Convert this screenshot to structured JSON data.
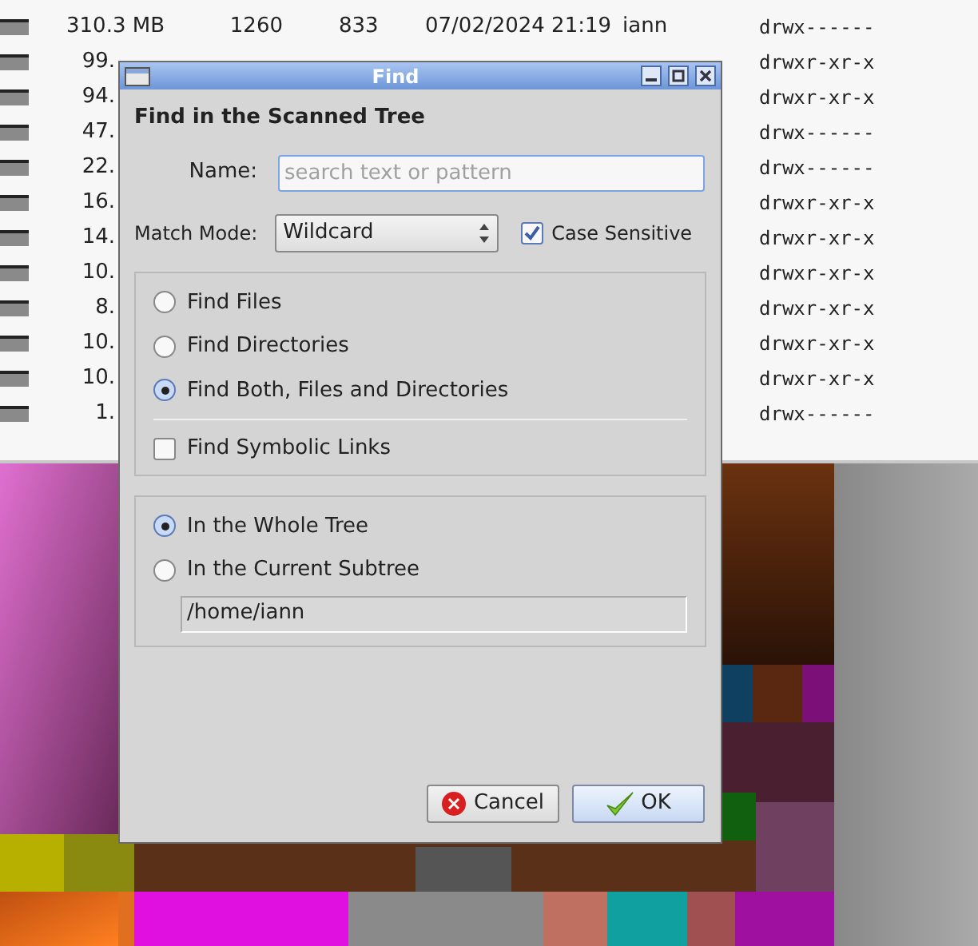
{
  "file_list": {
    "rows": [
      {
        "size": "310.3 MB",
        "items": "1260",
        "files": "833",
        "modified": "07/02/2024 21:19",
        "owner": "iann",
        "permissions": "drwx------"
      },
      {
        "size": "99.",
        "permissions": "drwxr-xr-x"
      },
      {
        "size": "94.",
        "permissions": "drwxr-xr-x"
      },
      {
        "size": "47.",
        "permissions": "drwx------"
      },
      {
        "size": "22.",
        "permissions": "drwx------"
      },
      {
        "size": "16.",
        "permissions": "drwxr-xr-x"
      },
      {
        "size": "14.",
        "permissions": "drwxr-xr-x"
      },
      {
        "size": "10.",
        "permissions": "drwxr-xr-x"
      },
      {
        "size": "8.",
        "permissions": "drwxr-xr-x"
      },
      {
        "size": "10.",
        "permissions": "drwxr-xr-x"
      },
      {
        "size": "10.",
        "permissions": "drwxr-xr-x"
      },
      {
        "size": "1.",
        "permissions": "drwx------"
      }
    ]
  },
  "dialog": {
    "title": "Find",
    "heading": "Find in the Scanned Tree",
    "name_label": "Name:",
    "name_placeholder": "search text or pattern",
    "match_mode_label": "Match Mode:",
    "match_mode_value": "Wildcard",
    "case_sensitive": {
      "label": "Case Sensitive",
      "checked": true
    },
    "find_options": [
      {
        "label": "Find Files",
        "selected": false
      },
      {
        "label": "Find Directories",
        "selected": false
      },
      {
        "label": "Find Both, Files and Directories",
        "selected": true
      }
    ],
    "symbolic_links": {
      "label": "Find Symbolic Links",
      "checked": false
    },
    "scope_options": [
      {
        "label": "In the Whole Tree",
        "selected": true
      },
      {
        "label": "In the Current Subtree",
        "selected": false
      }
    ],
    "subtree_path": "/home/iann",
    "buttons": [
      {
        "kind": "cancel",
        "label": "Cancel"
      },
      {
        "kind": "ok",
        "label": "OK"
      }
    ]
  }
}
